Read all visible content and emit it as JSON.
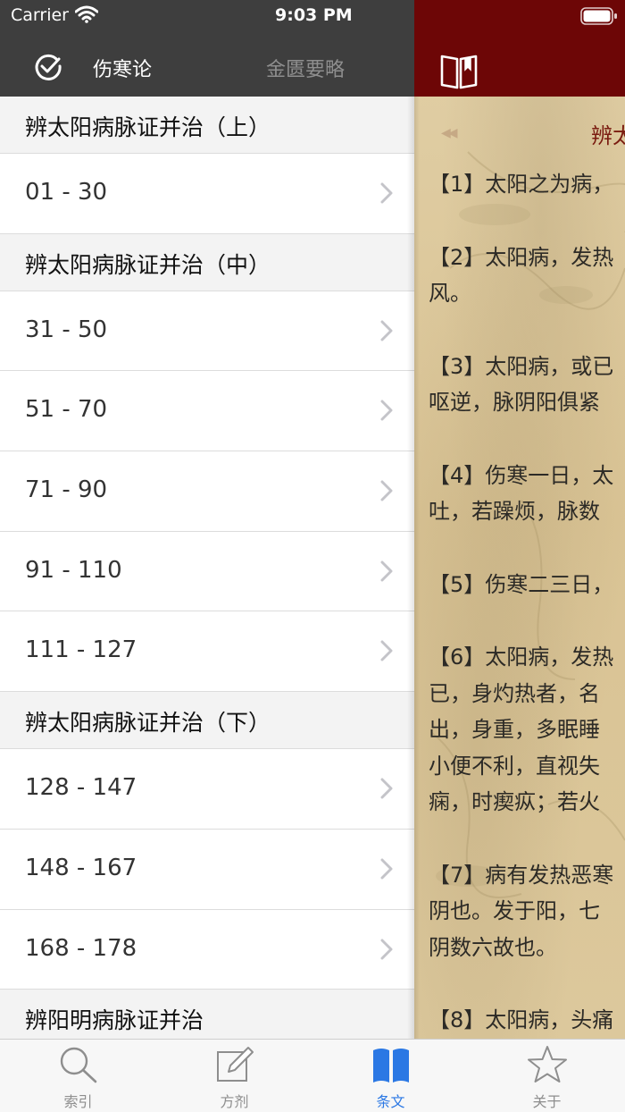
{
  "status_bar": {
    "carrier": "Carrier",
    "time": "9:03 PM"
  },
  "drawer": {
    "tabs": [
      {
        "label": "伤寒论",
        "active": true
      },
      {
        "label": "金匮要略",
        "active": false
      }
    ],
    "sections": [
      {
        "title": "辨太阳病脉证并治（上）",
        "rows": [
          "01 - 30"
        ]
      },
      {
        "title": "辨太阳病脉证并治（中）",
        "rows": [
          "31 - 50",
          "51 - 70",
          "71 - 90",
          "91 - 110",
          "111 - 127"
        ]
      },
      {
        "title": "辨太阳病脉证并治（下）",
        "rows": [
          "128 - 147",
          "148 - 167",
          "168 - 178"
        ]
      },
      {
        "title": "辨阳明病脉证并治",
        "rows": []
      }
    ]
  },
  "content": {
    "nav_prev": "◀◀",
    "chapter_title": "辨太",
    "verses": [
      "【1】太阳之为病，",
      "【2】太阳病，发热\n风。",
      "【3】太阳病，或已\n呕逆，脉阴阳俱紧",
      "【4】伤寒一日，太\n吐，若躁烦，脉数",
      "【5】伤寒二三日，",
      "【6】太阳病，发热\n已，身灼热者，名\n出，身重，多眠睡\n小便不利，直视失\n痫，时瘈疭；若火",
      "【7】病有发热恶寒\n阴也。发于阳，七\n阴数六故也。",
      "【8】太阳病，头痛"
    ]
  },
  "tabbar": {
    "items": [
      {
        "label": "索引",
        "icon": "search-icon",
        "active": false
      },
      {
        "label": "方剂",
        "icon": "edit-icon",
        "active": false
      },
      {
        "label": "条文",
        "icon": "book-icon",
        "active": true
      },
      {
        "label": "关于",
        "icon": "star-icon",
        "active": false
      }
    ]
  },
  "colors": {
    "accent": "#2b78e4",
    "header_dark": "#3e3e3e",
    "header_red": "#6d0606"
  }
}
